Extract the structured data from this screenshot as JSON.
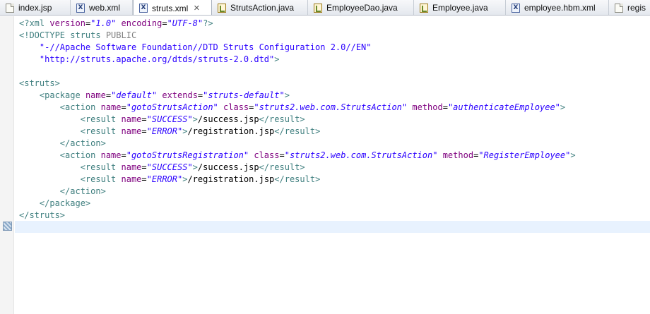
{
  "tabs": [
    {
      "label": "index.jsp",
      "icon": "jsp-file-icon",
      "active": false
    },
    {
      "label": "web.xml",
      "icon": "xml-file-icon",
      "active": false
    },
    {
      "label": "struts.xml",
      "icon": "xml-file-icon",
      "active": true
    },
    {
      "label": "StrutsAction.java",
      "icon": "java-file-icon",
      "active": false
    },
    {
      "label": "EmployeeDao.java",
      "icon": "java-file-icon",
      "active": false
    },
    {
      "label": "Employee.java",
      "icon": "java-file-icon",
      "active": false
    },
    {
      "label": "employee.hbm.xml",
      "icon": "xml-file-icon",
      "active": false
    },
    {
      "label": "regis",
      "icon": "jsp-file-icon",
      "active": false
    }
  ],
  "close_glyph": "✕",
  "colors": {
    "tag": "#3f7f7f",
    "attribute": "#7f007f",
    "value": "#2a00ff",
    "current_line": "#e8f2fe"
  },
  "code_lines": [
    [
      {
        "t": "pi",
        "s": "<?xml "
      },
      {
        "t": "attr",
        "s": "version"
      },
      {
        "t": "text",
        "s": "="
      },
      {
        "t": "val",
        "s": "\"1.0\""
      },
      {
        "t": "text",
        "s": " "
      },
      {
        "t": "attr",
        "s": "encoding"
      },
      {
        "t": "text",
        "s": "="
      },
      {
        "t": "val",
        "s": "\"UTF-8\""
      },
      {
        "t": "pi",
        "s": "?>"
      }
    ],
    [
      {
        "t": "doc",
        "s": "<!DOCTYPE "
      },
      {
        "t": "doc",
        "s": "struts "
      },
      {
        "t": "kw",
        "s": "PUBLIC"
      }
    ],
    [
      {
        "t": "text",
        "s": "    "
      },
      {
        "t": "pub",
        "s": "\"-//Apache Software Foundation//DTD Struts Configuration 2.0//EN\""
      }
    ],
    [
      {
        "t": "text",
        "s": "    "
      },
      {
        "t": "pub",
        "s": "\"http://struts.apache.org/dtds/struts-2.0.dtd\""
      },
      {
        "t": "doc",
        "s": ">"
      }
    ],
    [],
    [
      {
        "t": "tag",
        "s": "<struts>"
      }
    ],
    [
      {
        "t": "text",
        "s": "    "
      },
      {
        "t": "tag",
        "s": "<package "
      },
      {
        "t": "attr",
        "s": "name"
      },
      {
        "t": "text",
        "s": "="
      },
      {
        "t": "val",
        "s": "\"default\""
      },
      {
        "t": "text",
        "s": " "
      },
      {
        "t": "attr",
        "s": "extends"
      },
      {
        "t": "text",
        "s": "="
      },
      {
        "t": "val",
        "s": "\"struts-default\""
      },
      {
        "t": "tag",
        "s": ">"
      }
    ],
    [
      {
        "t": "text",
        "s": "        "
      },
      {
        "t": "tag",
        "s": "<action "
      },
      {
        "t": "attr",
        "s": "name"
      },
      {
        "t": "text",
        "s": "="
      },
      {
        "t": "val",
        "s": "\"gotoStrutsAction\""
      },
      {
        "t": "text",
        "s": " "
      },
      {
        "t": "attr",
        "s": "class"
      },
      {
        "t": "text",
        "s": "="
      },
      {
        "t": "val",
        "s": "\"struts2.web.com.StrutsAction\""
      },
      {
        "t": "text",
        "s": " "
      },
      {
        "t": "attr",
        "s": "method"
      },
      {
        "t": "text",
        "s": "="
      },
      {
        "t": "val",
        "s": "\"authenticateEmployee\""
      },
      {
        "t": "tag",
        "s": ">"
      }
    ],
    [
      {
        "t": "text",
        "s": "            "
      },
      {
        "t": "tag",
        "s": "<result "
      },
      {
        "t": "attr",
        "s": "name"
      },
      {
        "t": "text",
        "s": "="
      },
      {
        "t": "val",
        "s": "\"SUCCESS\""
      },
      {
        "t": "tag",
        "s": ">"
      },
      {
        "t": "text",
        "s": "/success.jsp"
      },
      {
        "t": "tag",
        "s": "</result>"
      }
    ],
    [
      {
        "t": "text",
        "s": "            "
      },
      {
        "t": "tag",
        "s": "<result "
      },
      {
        "t": "attr",
        "s": "name"
      },
      {
        "t": "text",
        "s": "="
      },
      {
        "t": "val",
        "s": "\"ERROR\""
      },
      {
        "t": "tag",
        "s": ">"
      },
      {
        "t": "text",
        "s": "/registration.jsp"
      },
      {
        "t": "tag",
        "s": "</result>"
      }
    ],
    [
      {
        "t": "text",
        "s": "        "
      },
      {
        "t": "tag",
        "s": "</action>"
      }
    ],
    [
      {
        "t": "text",
        "s": "        "
      },
      {
        "t": "tag",
        "s": "<action "
      },
      {
        "t": "attr",
        "s": "name"
      },
      {
        "t": "text",
        "s": "="
      },
      {
        "t": "val",
        "s": "\"gotoStrutsRegistration\""
      },
      {
        "t": "text",
        "s": " "
      },
      {
        "t": "attr",
        "s": "class"
      },
      {
        "t": "text",
        "s": "="
      },
      {
        "t": "val",
        "s": "\"struts2.web.com.StrutsAction\""
      },
      {
        "t": "text",
        "s": " "
      },
      {
        "t": "attr",
        "s": "method"
      },
      {
        "t": "text",
        "s": "="
      },
      {
        "t": "val",
        "s": "\"RegisterEmployee\""
      },
      {
        "t": "tag",
        "s": ">"
      }
    ],
    [
      {
        "t": "text",
        "s": "            "
      },
      {
        "t": "tag",
        "s": "<result "
      },
      {
        "t": "attr",
        "s": "name"
      },
      {
        "t": "text",
        "s": "="
      },
      {
        "t": "val",
        "s": "\"SUCCESS\""
      },
      {
        "t": "tag",
        "s": ">"
      },
      {
        "t": "text",
        "s": "/success.jsp"
      },
      {
        "t": "tag",
        "s": "</result>"
      }
    ],
    [
      {
        "t": "text",
        "s": "            "
      },
      {
        "t": "tag",
        "s": "<result "
      },
      {
        "t": "attr",
        "s": "name"
      },
      {
        "t": "text",
        "s": "="
      },
      {
        "t": "val",
        "s": "\"ERROR\""
      },
      {
        "t": "tag",
        "s": ">"
      },
      {
        "t": "text",
        "s": "/registration.jsp"
      },
      {
        "t": "tag",
        "s": "</result>"
      }
    ],
    [
      {
        "t": "text",
        "s": "        "
      },
      {
        "t": "tag",
        "s": "</action>"
      }
    ],
    [
      {
        "t": "text",
        "s": "    "
      },
      {
        "t": "tag",
        "s": "</package>"
      }
    ],
    [
      {
        "t": "tag",
        "s": "</struts>"
      }
    ],
    []
  ]
}
